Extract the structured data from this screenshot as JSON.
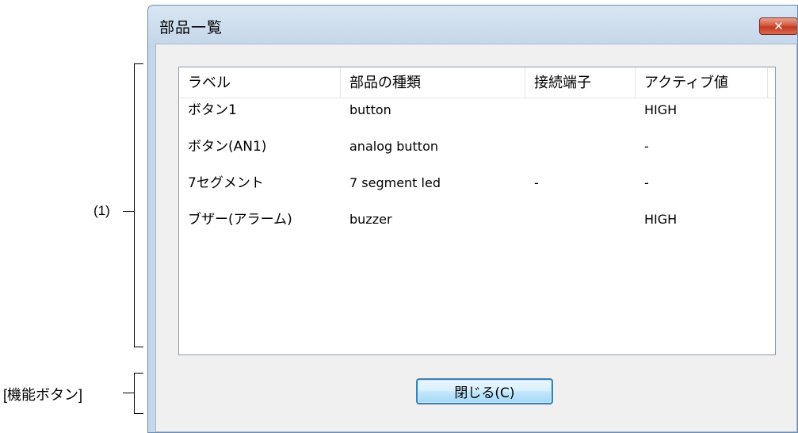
{
  "dialog": {
    "title": "部品一覧",
    "close_icon_glyph": "✕",
    "columns": [
      "ラベル",
      "部品の種類",
      "接続端子",
      "アクティブ値"
    ],
    "rows": [
      [
        "ボタン1",
        "button",
        "",
        "HIGH"
      ],
      [
        "ボタン(AN1)",
        "analog button",
        "",
        "-"
      ],
      [
        "7セグメント",
        "7 segment led",
        "-",
        "-"
      ],
      [
        "ブザー(アラーム)",
        "buzzer",
        "",
        "HIGH"
      ]
    ],
    "close_button_label": "閉じる(C)"
  },
  "annotations": {
    "list_label": "(1)",
    "button_area_label": "[機能ボタン]"
  }
}
